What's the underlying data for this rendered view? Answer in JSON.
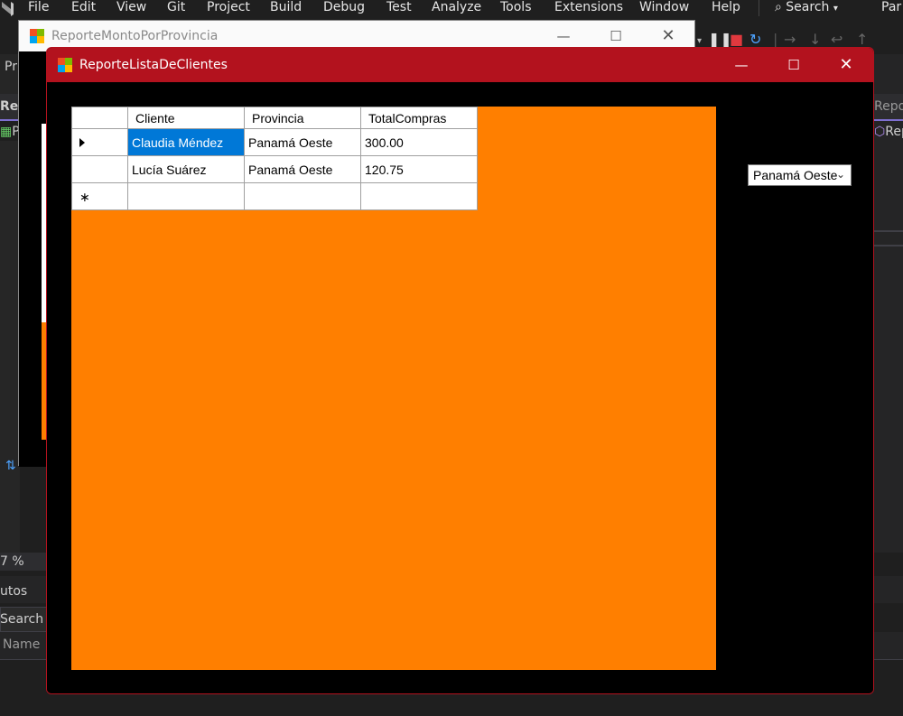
{
  "vs": {
    "menu": [
      "File",
      "Edit",
      "View",
      "Git",
      "Project",
      "Build",
      "Debug",
      "Test",
      "Analyze",
      "Tools",
      "Extensions",
      "Window",
      "Help"
    ],
    "search_label": "Search",
    "user_initial": "Par",
    "side": {
      "pr": "Pr",
      "repo_left": "Repo",
      "p_left": "P",
      "report_right": "Report",
      "rep_right": "Rep",
      "zoom": "7 %",
      "autos": "utos",
      "search": "Search (C",
      "name": "Name"
    }
  },
  "back_window": {
    "title": "ReporteMontoPorProvincia"
  },
  "front_window": {
    "title": "ReporteListaDeClientes",
    "accent_color": "#b3121e",
    "panel_color": "#ff7f00",
    "grid": {
      "columns": [
        "Cliente",
        "Provincia",
        "TotalCompras"
      ],
      "rows": [
        {
          "cliente": "Claudia Méndez",
          "provincia": "Panamá Oeste",
          "total": "300.00",
          "selected": true
        },
        {
          "cliente": "Lucía Suárez",
          "provincia": "Panamá Oeste",
          "total": "120.75",
          "selected": false
        }
      ]
    },
    "province_select": {
      "selected": "Panamá Oeste"
    }
  }
}
